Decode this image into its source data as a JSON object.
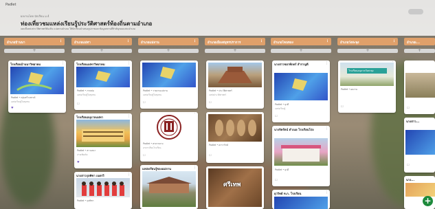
{
  "app": {
    "name": "Padlet"
  },
  "board": {
    "author": "ผลงานโดย นักเรียน ม.4",
    "title": "ท่องเที่ยวชมแหล่งเรียนรู้ประวัติศาสตร์ท้องถิ่นตามอำเภอ",
    "description": "แผนที่แหล่งประวัติศาสตร์ท้องถิ่น แบ่งตามอำเภอ ให้นักเรียนนำเสนอรูปภาพและข้อมูลสถานที่สำคัญของแต่ละอำเภอ"
  },
  "columns": [
    {
      "title": "อำเภอบ้านนา"
    },
    {
      "title": "อำเภอแม่ทา"
    },
    {
      "title": "อำเภอแม่ลาน"
    },
    {
      "title": "อำเภอเมืองสมุทรปราการ"
    },
    {
      "title": "อำเภอโพนทอง"
    },
    {
      "title": "อำเภอวังสะพุง"
    },
    {
      "title": "อำเภอเ..."
    }
  ],
  "cards": {
    "c1": {
      "title": "โรงเรียนบ้านนาวิทยาคม",
      "meta": "Padlet • กลุ่มสร้างสรรค์",
      "caption": "แหล่งเรียนรู้ในชุมชน"
    },
    "c2": {
      "title": "โรงเรียนแม่ทาวิทยาคม",
      "meta": "Padlet • ภาคต่อ",
      "caption": "แหล่งเรียนรู้ในชุมชน"
    },
    "c3": {
      "title": "โรงเรียนอนุบาลแม่ทา",
      "meta": "Padlet • สาวเลนา",
      "caption": "อ่านเพิ่มเติม"
    },
    "c4": {
      "title": "นางสาวกุลพิชา เนตรวี",
      "meta": "Padlet • กุลพิชา",
      "caption": ""
    },
    "c5": {
      "title": "",
      "meta": "Padlet • รายงานแม่ลาน",
      "caption": "แหล่งเรียนรู้ในชุมชน"
    },
    "c6": {
      "title": "",
      "meta": "Padlet • ศาลากลาง",
      "caption": "อาคารเรียนโรงเรียน"
    },
    "c7": {
      "title": "แหล่งเรียนรู้ของแม่ลาน",
      "meta": "",
      "caption": ""
    },
    "c8": {
      "title": "",
      "meta": "Padlet • ประวัติศาสตร์",
      "caption": "แหล่งประวัติศาสตร์"
    },
    "c9": {
      "title": "",
      "meta": "Padlet • ดารารักษ์",
      "caption": ""
    },
    "c10": {
      "title": "",
      "meta": "",
      "caption": "",
      "sign": "ศรีเทพ"
    },
    "c11": {
      "title": "นางสาวชยาพักตร์ สำราญดี",
      "meta": "Padlet • ยุวดี",
      "caption": "แหล่งเรียนรู้"
    },
    "c12": {
      "title": "นางจิตรัตน์ ดำเนย โรงเรียนโป่ง",
      "meta": "Padlet • ยุวดี",
      "caption": ""
    },
    "c13": {
      "title": "ยุววิทย์ ท.ก. โรงเรียน",
      "meta": "",
      "caption": ""
    },
    "c14": {
      "title": "",
      "meta": "Padlet • ผลงาน",
      "caption": "",
      "sign": "โรงเรียนอนุบาลวังสะพุง"
    },
    "c15": {
      "title": "",
      "meta": "",
      "caption": ""
    },
    "c16": {
      "title": "นางสาว...",
      "meta": "",
      "caption": ""
    },
    "c17": {
      "title": "นางสาว...",
      "meta": "",
      "caption": ""
    },
    "c18": {
      "title": "นาง...",
      "meta": "",
      "caption": ""
    }
  },
  "icons": {
    "more": "⋮",
    "plus": "+",
    "comment": "☐",
    "heart": "♥"
  },
  "colors": {
    "column_header": "#e0a06a",
    "fab": "#1e8a3c"
  }
}
